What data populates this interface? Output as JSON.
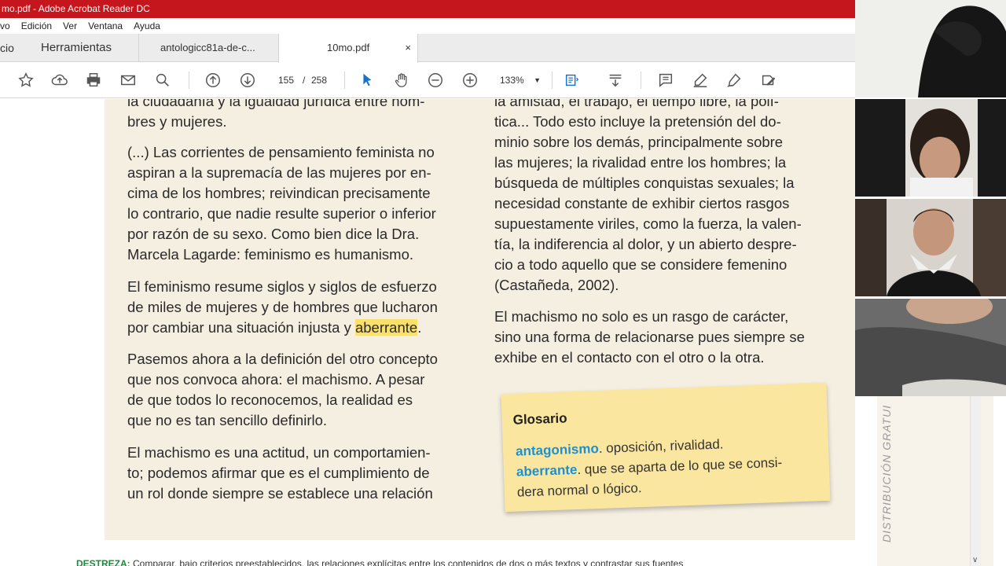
{
  "window": {
    "title": "mo.pdf - Adobe Acrobat Reader DC"
  },
  "menu": [
    "vo",
    "Edición",
    "Ver",
    "Ventana",
    "Ayuda"
  ],
  "tabs": {
    "home": "cio",
    "tools": "Herramientas",
    "doc1": "antologicc81a-de-c...",
    "doc2": "10mo.pdf",
    "close": "×"
  },
  "toolbar": {
    "page_current": "155",
    "page_sep": "/",
    "page_total": "258",
    "zoom": "133%"
  },
  "document": {
    "col1": {
      "p0": [
        "la ciudadanía y la igualdad jurídica entre hom-",
        "bres y mujeres."
      ],
      "p1": [
        "(...) Las corrientes de pensamiento feminista no",
        "aspiran a la supremacía de las mujeres por en-",
        "cima de los hombres; reivindican precisamente",
        "lo contrario, que nadie resulte superior o inferior",
        "por razón de su sexo. Como bien dice la Dra.",
        "Marcela Lagarde: feminismo es humanismo."
      ],
      "p2a": [
        "El feminismo resume siglos y siglos de esfuerzo",
        "de miles de mujeres y de hombres que lucharon"
      ],
      "p2b_pre": "por cambiar una situación injusta y ",
      "p2b_hl": "aberrante",
      "p2b_post": ".",
      "p3": [
        "Pasemos ahora a la definición del otro concepto",
        "que nos convoca ahora: el machismo. A pesar",
        "de que todos lo reconocemos, la realidad es",
        "que no es tan sencillo definirlo."
      ],
      "p4": [
        "El machismo es una actitud, un comportamien-",
        "to; podemos afirmar que es el cumplimiento de",
        "un rol donde siempre se establece una relación"
      ]
    },
    "col2": {
      "p0": [
        "la amistad, el trabajo, el tiempo libre, la polí-",
        "tica... Todo esto incluye la pretensión del do-",
        "minio sobre los demás, principalmente sobre",
        "las mujeres; la rivalidad entre los hombres; la",
        "búsqueda de múltiples conquistas sexuales; la",
        "necesidad constante de exhibir ciertos rasgos",
        "supuestamente viriles, como la fuerza, la valen-",
        "tía, la indiferencia al dolor, y un abierto despre-",
        "cio a todo aquello que se considere femenino",
        "(Castañeda, 2002)."
      ],
      "p1": [
        "El machismo no solo es un rasgo de carácter,",
        "sino una forma de relacionarse pues siempre se",
        "exhibe en el contacto con el otro o la otra."
      ]
    },
    "glossary": {
      "title": "Glosario",
      "t1": "antagonismo",
      "d1": ". oposición, rivalidad.",
      "t2": "aberrante",
      "d2": ". que se aparta de lo que se consi-",
      "d3": "dera normal o lógico."
    },
    "bottom": {
      "label": "DESTREZA:",
      "text": " Comparar, bajo criterios preestablecidos, las relaciones explícitas entre los contenidos de dos o más textos y contrastar sus fuentes"
    },
    "side_label": "DISTRIBUCIÓN GRATUI"
  }
}
